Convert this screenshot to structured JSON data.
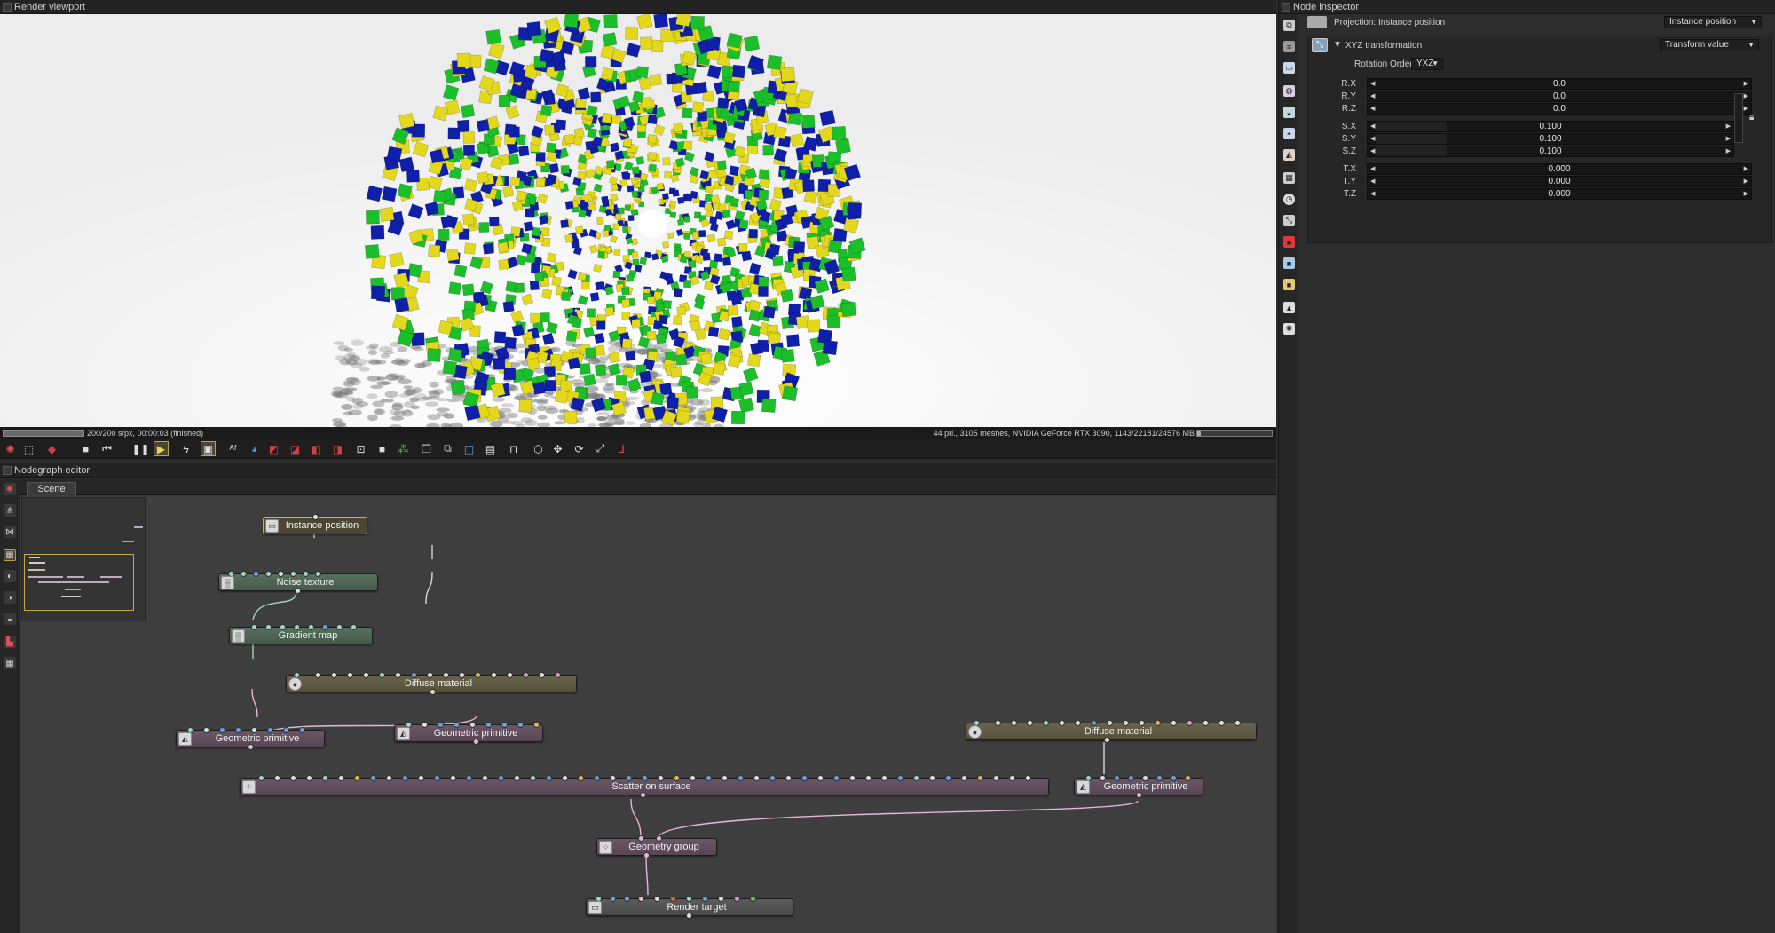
{
  "panels": {
    "viewport_title": "Render viewport",
    "nodegraph_title": "Nodegraph editor",
    "inspector_title": "Node inspector"
  },
  "status": {
    "left": "200/200 s/px, 00:00:03 (finished)",
    "right": "44 pri., 3105 meshes, NVIDIA GeForce RTX 3090, 1143/22181/24576 MB",
    "progress": 1.0
  },
  "nodegraph": {
    "tab": "Scene",
    "nodes": {
      "instance_position": "Instance position",
      "noise_texture": "Noise texture",
      "gradient_map": "Gradient map",
      "diffuse_material_1": "Diffuse material",
      "geometric_primitive_1": "Geometric primitive",
      "geometric_primitive_2": "Geometric primitive",
      "diffuse_material_2": "Diffuse material",
      "geometric_primitive_3": "Geometric primitive",
      "scatter_on_surface": "Scatter on surface",
      "geometry_group": "Geometry group",
      "render_target": "Render target"
    }
  },
  "inspector": {
    "projection_label": "Projection: Instance position",
    "projection_value": "Instance position",
    "transform_label": "XYZ transformation",
    "transform_value": "Transform value",
    "rotation_order_label": "Rotation Order",
    "rotation_order_value": "YXZ",
    "rows": [
      {
        "label": "R.X",
        "value": "0.0"
      },
      {
        "label": "R.Y",
        "value": "0.0"
      },
      {
        "label": "R.Z",
        "value": "0.0"
      },
      {
        "label": "S.X",
        "value": "0.100"
      },
      {
        "label": "S.Y",
        "value": "0.100"
      },
      {
        "label": "S.Z",
        "value": "0.100"
      },
      {
        "label": "T.X",
        "value": "0.000"
      },
      {
        "label": "T.Y",
        "value": "0.000"
      },
      {
        "label": "T.Z",
        "value": "0.000"
      }
    ]
  },
  "colors": {
    "cube_yellow": "#e4d81c",
    "cube_blue": "#0f1fa8",
    "cube_green": "#1bbf2a",
    "selection": "#d2b14c"
  }
}
